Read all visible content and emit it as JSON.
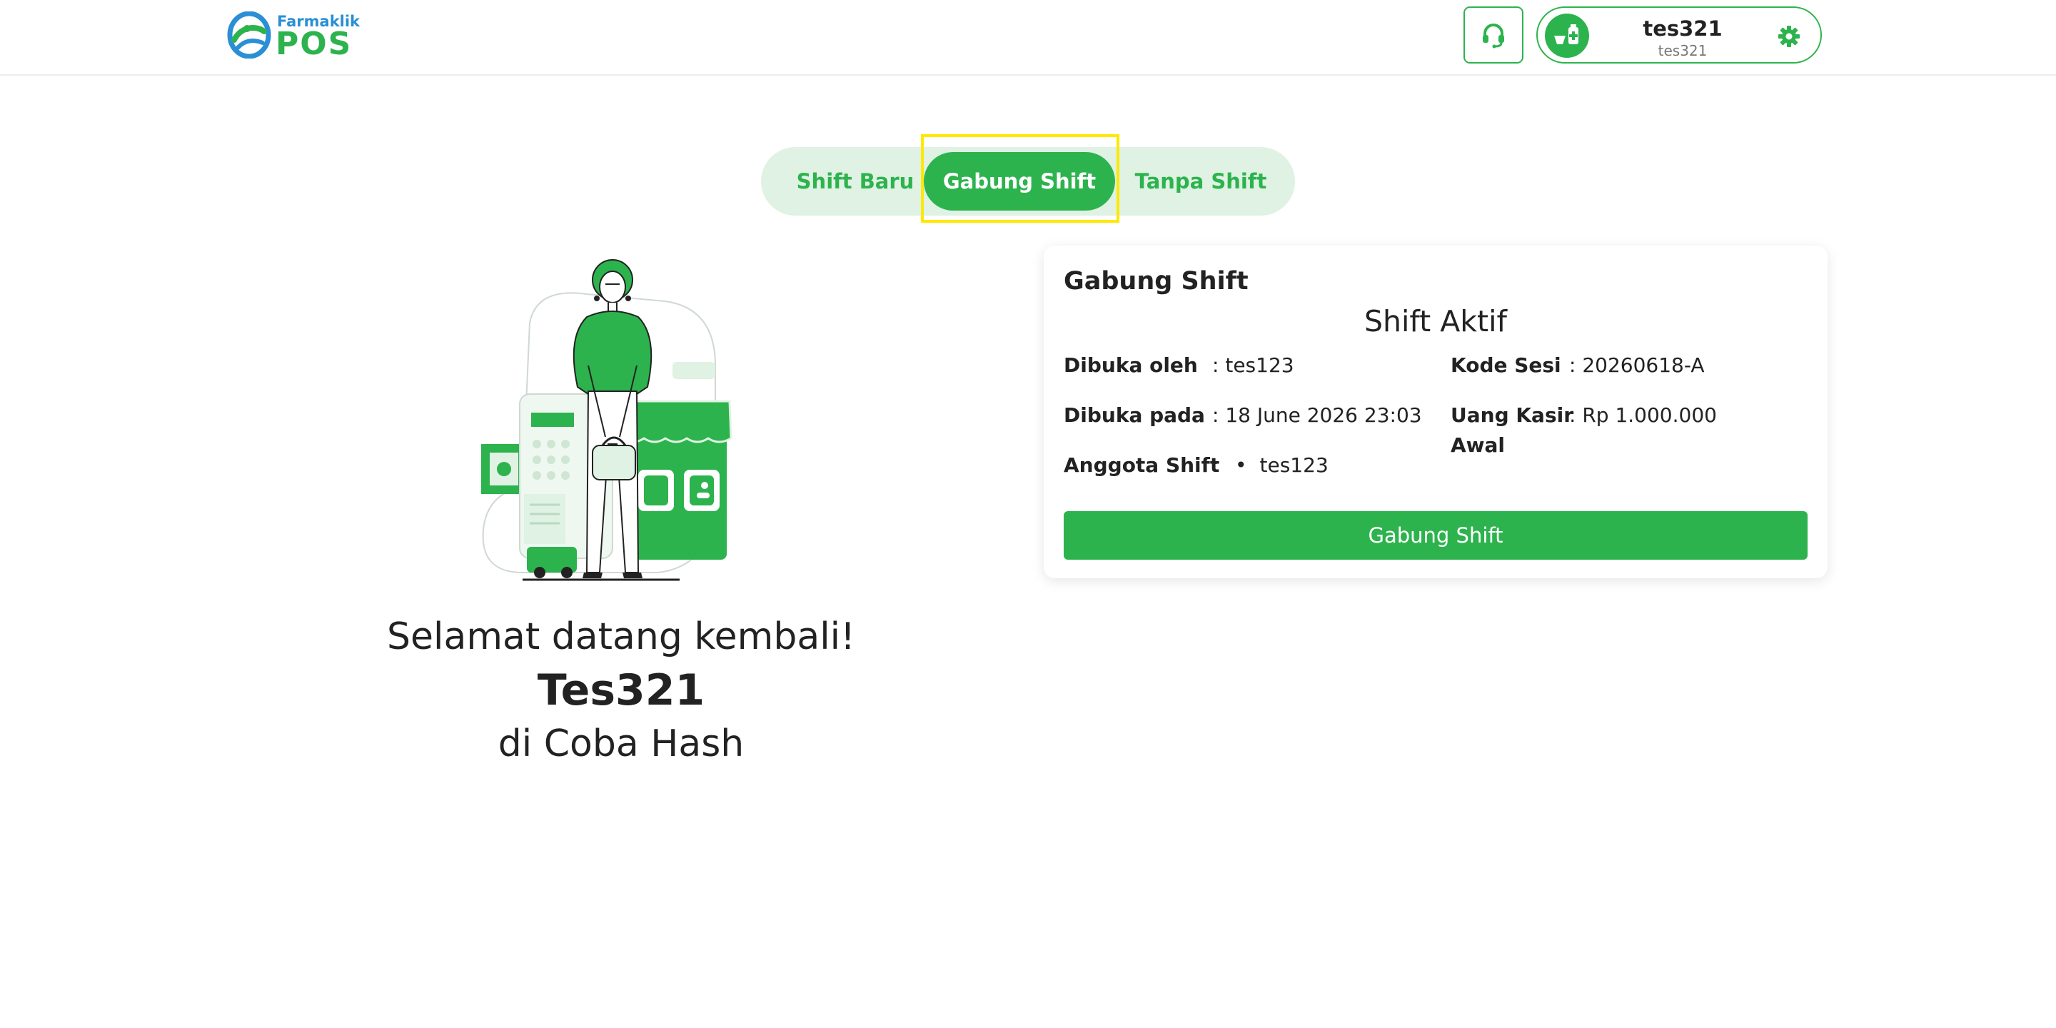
{
  "header": {
    "logo_small": "Farmaklik",
    "logo_big": "POS",
    "user_name": "tes321",
    "user_sub": "tes321"
  },
  "tabs": [
    {
      "label": "Shift Baru",
      "active": false
    },
    {
      "label": "Gabung Shift",
      "active": true
    },
    {
      "label": "Tanpa Shift",
      "active": false
    }
  ],
  "welcome": {
    "line1": "Selamat datang kembali!",
    "name": "Tes321",
    "line3": "di Coba Hash"
  },
  "card": {
    "title": "Gabung Shift",
    "subtitle": "Shift Aktif",
    "opened_by_label": "Dibuka oleh",
    "opened_by_value": ": tes123",
    "opened_at_label": "Dibuka pada",
    "opened_at_value": ": 18 June 2026 23:03",
    "members_label": "Anggota Shift",
    "members_colon": ":",
    "members": [
      "tes123"
    ],
    "session_code_label": "Kode Sesi",
    "session_code_value": ": 20260618-A",
    "cash_label_1": "Uang Kasir",
    "cash_label_2": "Awal",
    "cash_value": ": Rp 1.000.000",
    "button_label": "Gabung Shift"
  },
  "colors": {
    "accent": "#2db34d",
    "accent_light": "#dff2e3",
    "logo_blue": "#2a8fd4",
    "focus": "#ffe800"
  },
  "icons": {
    "support": "headset-icon",
    "avatar": "pharmacy-avatar-icon",
    "settings": "gear-icon"
  }
}
